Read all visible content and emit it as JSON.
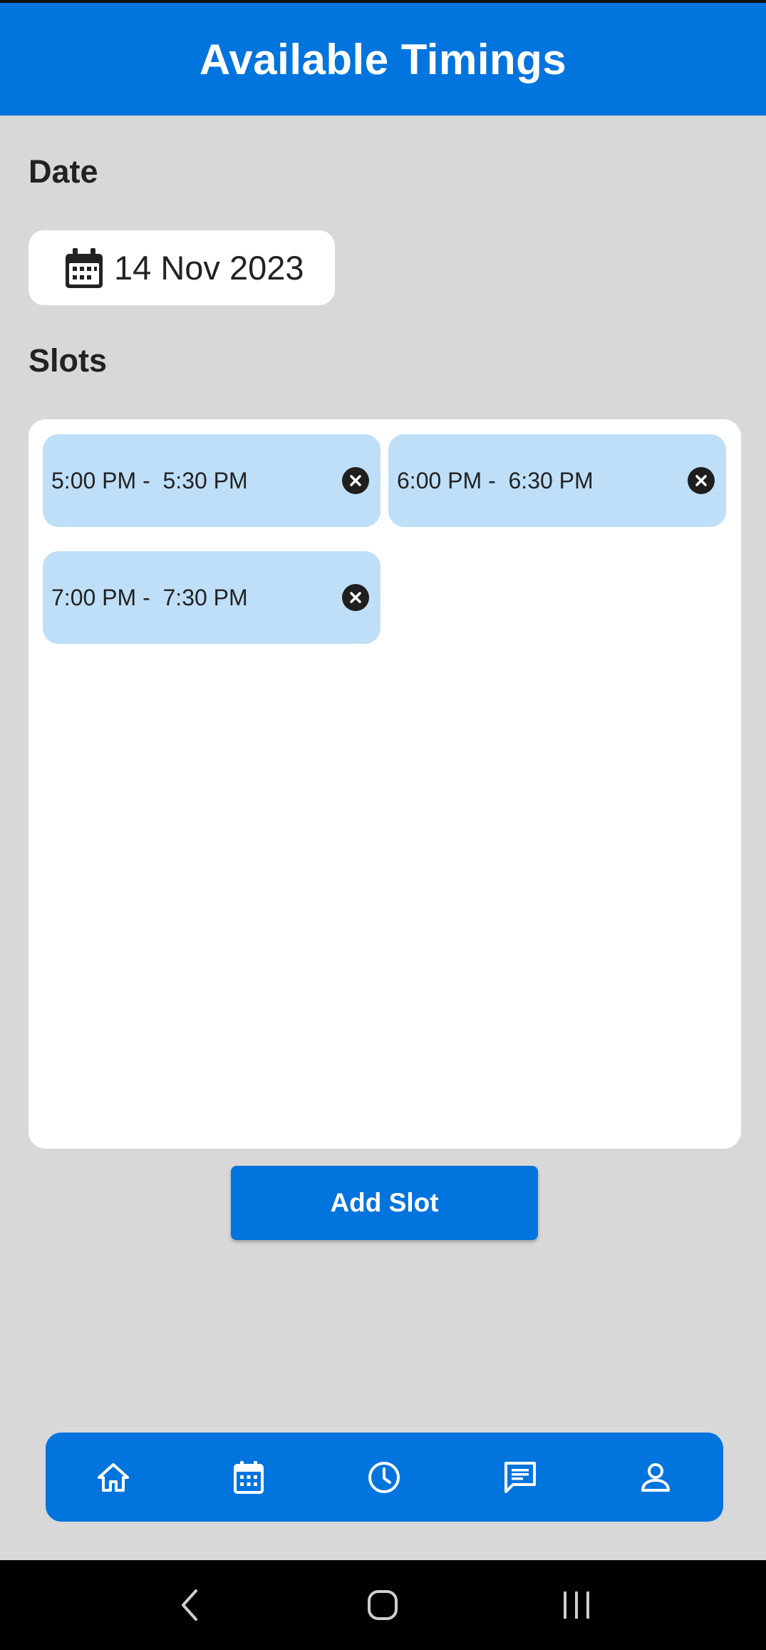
{
  "header": {
    "title": "Available Timings"
  },
  "date_section": {
    "label": "Date",
    "selected_date": "14 Nov 2023"
  },
  "slots_section": {
    "label": "Slots",
    "slots": [
      {
        "label": "5:00 PM -  5:30 PM"
      },
      {
        "label": "6:00 PM -  6:30 PM"
      },
      {
        "label": "7:00 PM -  7:30 PM"
      }
    ]
  },
  "add_slot_button": {
    "label": "Add Slot"
  },
  "bottom_nav": {
    "items": [
      {
        "icon": "home-icon"
      },
      {
        "icon": "calendar-icon"
      },
      {
        "icon": "clock-icon"
      },
      {
        "icon": "chat-icon"
      },
      {
        "icon": "profile-icon"
      }
    ]
  },
  "system_nav": {
    "buttons": [
      {
        "icon": "back-icon"
      },
      {
        "icon": "home-circle-icon"
      },
      {
        "icon": "recent-apps-icon"
      }
    ]
  },
  "colors": {
    "primary": "#0174dd",
    "background": "#d8d8d8",
    "slot_chip": "#bfdff8",
    "panel": "#ffffff",
    "system_bar": "#000000"
  }
}
